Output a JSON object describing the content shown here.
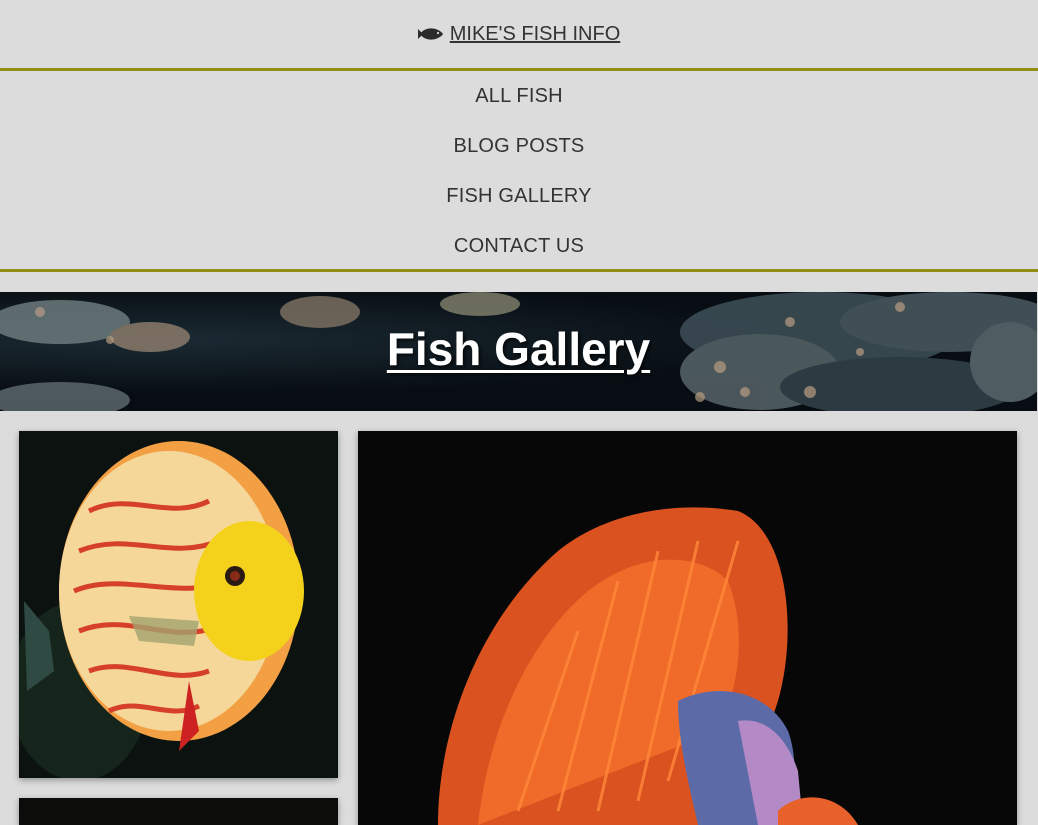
{
  "site": {
    "brand": "MIKE'S FISH INFO",
    "brand_icon": "fish-icon",
    "accent_color": "#8f8f14"
  },
  "nav": {
    "items": [
      "ALL FISH",
      "BLOG POSTS",
      "FISH GALLERY",
      "CONTACT US"
    ]
  },
  "banner": {
    "title": "Fish Gallery"
  },
  "gallery": {
    "images": [
      "discus-fish-photo",
      "betta-fish-photo",
      "dark-fish-photo"
    ]
  }
}
